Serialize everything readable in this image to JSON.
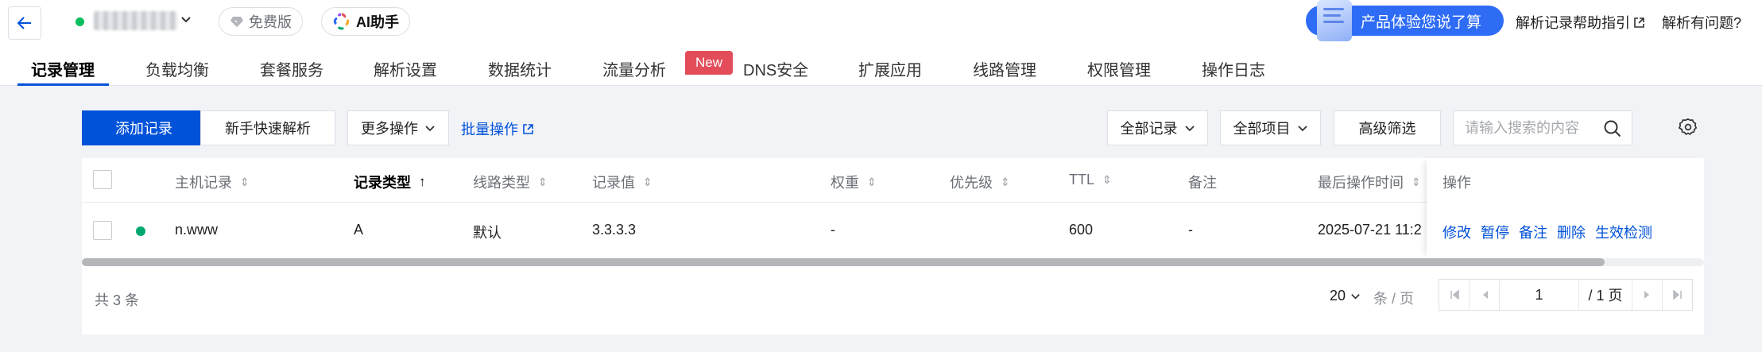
{
  "header": {
    "free_label": "免费版",
    "ai_label": "AI助手",
    "promo_label": "产品体验您说了算",
    "help_link": "解析记录帮助指引",
    "question_link": "解析有问题?"
  },
  "tabs": [
    {
      "label": "记录管理",
      "active": true
    },
    {
      "label": "负载均衡"
    },
    {
      "label": "套餐服务"
    },
    {
      "label": "解析设置"
    },
    {
      "label": "数据统计"
    },
    {
      "label": "流量分析"
    },
    {
      "label": "DNS安全"
    },
    {
      "label": "扩展应用"
    },
    {
      "label": "线路管理"
    },
    {
      "label": "权限管理"
    },
    {
      "label": "操作日志"
    }
  ],
  "new_badge": "New",
  "toolbar": {
    "add_record": "添加记录",
    "quick_resolve": "新手快速解析",
    "more_ops": "更多操作",
    "batch_ops": "批量操作",
    "all_records": "全部记录",
    "all_projects": "全部项目",
    "advanced_filter": "高级筛选",
    "search_placeholder": "请输入搜索的内容"
  },
  "table": {
    "columns": {
      "host": "主机记录",
      "type": "记录类型",
      "line": "线路类型",
      "value": "记录值",
      "weight": "权重",
      "priority": "优先级",
      "ttl": "TTL",
      "remark": "备注",
      "last_op_time": "最后操作时间",
      "ops": "操作"
    },
    "rows": [
      {
        "host": "n.www",
        "type": "A",
        "line": "默认",
        "value": "3.3.3.3",
        "weight": "-",
        "ttl": "600",
        "remark": "-",
        "last_op_time": "2025-07-21 11:2",
        "ops": [
          "修改",
          "暂停",
          "备注",
          "删除",
          "生效检测"
        ]
      }
    ]
  },
  "footer": {
    "total": "共 3 条",
    "page_size": "20",
    "page_size_unit": "条 / 页",
    "current_page": "1",
    "total_pages": "/ 1 页"
  },
  "colors": {
    "primary": "#0052d9",
    "promo": "#2e6cf6",
    "status_green": "#00a870",
    "new_badge": "#e34d59"
  }
}
